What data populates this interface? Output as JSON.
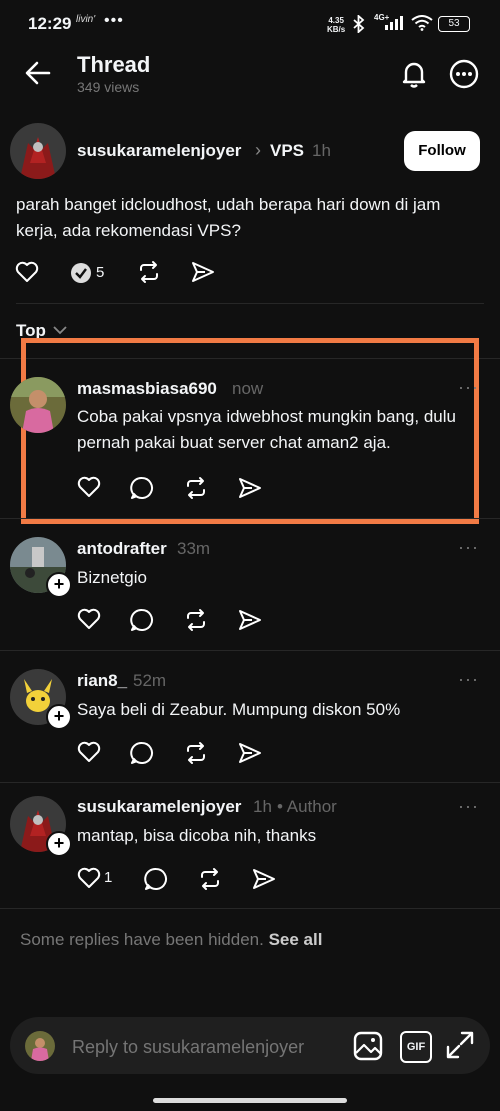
{
  "status_bar": {
    "time": "12:29",
    "carrier": "livin'",
    "dots": "•••",
    "speed_value": "4.35",
    "speed_unit": "KB/s",
    "network": "4G+",
    "battery": "53"
  },
  "header": {
    "title": "Thread",
    "views": "349 views"
  },
  "post": {
    "username": "susukaramelenjoyer",
    "topic": "VPS",
    "time": "1h",
    "follow_label": "Follow",
    "text": "parah banget idcloudhost, udah berapa hari down di jam kerja, ada rekomendasi VPS?",
    "reply_count": "5"
  },
  "sort": {
    "label": "Top"
  },
  "replies": [
    {
      "username": "masmasbiasa690",
      "time": "now",
      "text": "Coba pakai vpsnya idwebhost mungkin bang, dulu pernah pakai buat server chat aman2 aja."
    },
    {
      "username": "antodrafter",
      "time": "33m",
      "text": "Biznetgio"
    },
    {
      "username": "rian8_",
      "time": "52m",
      "text": "Saya beli di Zeabur. Mumpung diskon 50%"
    },
    {
      "username": "susukaramelenjoyer",
      "time": "1h",
      "author_tag": "• Author",
      "text": "mantap, bisa dicoba nih, thanks",
      "like_count": "1"
    }
  ],
  "hidden_notice": {
    "text": "Some replies have been hidden.",
    "link": "See all"
  },
  "reply_bar": {
    "placeholder": "Reply to susukaramelenjoyer",
    "gif_label": "GIF"
  },
  "colors": {
    "background": "#101010",
    "highlight_border": "#f27b45",
    "muted_text": "#777777"
  }
}
